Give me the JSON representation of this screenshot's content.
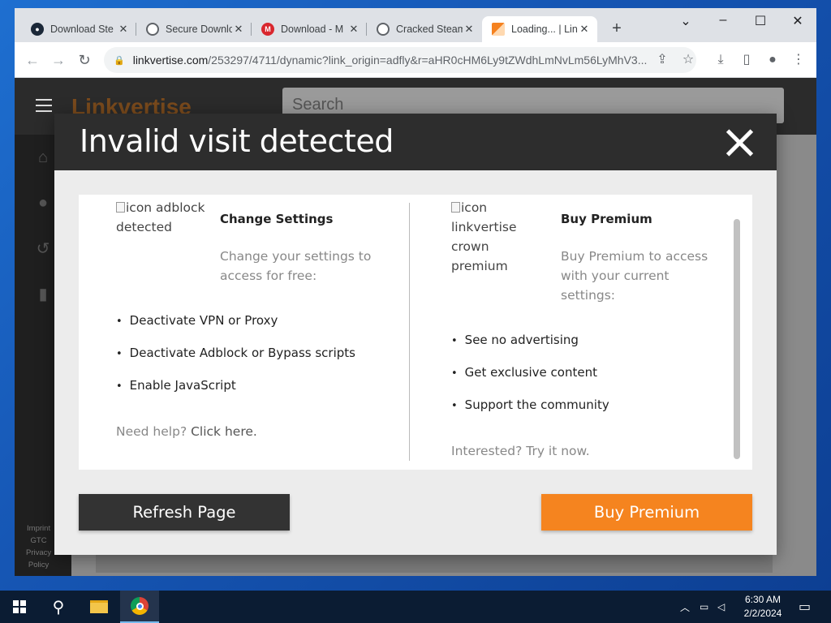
{
  "browser": {
    "tabs": [
      {
        "title": "Download Ste",
        "favicon": "steam-icon",
        "active": false
      },
      {
        "title": "Secure Downlo",
        "favicon": "globe-icon",
        "active": false
      },
      {
        "title": "Download - M",
        "favicon": "mega-icon",
        "active": false
      },
      {
        "title": "Cracked Steam",
        "favicon": "globe-icon",
        "active": false
      },
      {
        "title": "Loading... | Lin",
        "favicon": "linkvertise-icon",
        "active": true
      }
    ],
    "new_tab_symbol": "+",
    "url_host": "linkvertise.com",
    "url_path": "/253297/4711/dynamic?link_origin=adfly&r=aHR0cHM6Ly9tZWdhLmNvLm56LyMhV3..."
  },
  "site": {
    "logo_text": "Linkvertise",
    "search_placeholder": "Search",
    "sidebar_links": [
      "Imprint",
      "GTC",
      "Privacy",
      "Policy"
    ]
  },
  "modal": {
    "title": "Invalid visit detected",
    "left": {
      "img_alt_1": "icon adblock",
      "img_alt_2": "detected",
      "title": "Change Settings",
      "desc_1": "Change your settings to",
      "desc_2": "access for free:",
      "bullets": [
        "Deactivate VPN or Proxy",
        "Deactivate Adblock or Bypass scripts",
        "Enable JavaScript"
      ],
      "help_prefix": "Need help? ",
      "help_link": "Click here."
    },
    "right": {
      "img_alt_1": "icon",
      "img_alt_2": "linkvertise",
      "img_alt_3": "crown premium",
      "title": "Buy Premium",
      "desc_1": "Buy Premium to access",
      "desc_2": "with your current",
      "desc_3": "settings:",
      "bullets": [
        "See no advertising",
        "Get exclusive content",
        "Support the community"
      ],
      "footer": "Interested? Try it now."
    },
    "refresh_label": "Refresh Page",
    "premium_label": "Buy Premium"
  },
  "taskbar": {
    "time": "6:30 AM",
    "date": "2/2/2024"
  },
  "colors": {
    "accent_orange": "#f5841f",
    "dark": "#2d2d2d"
  }
}
